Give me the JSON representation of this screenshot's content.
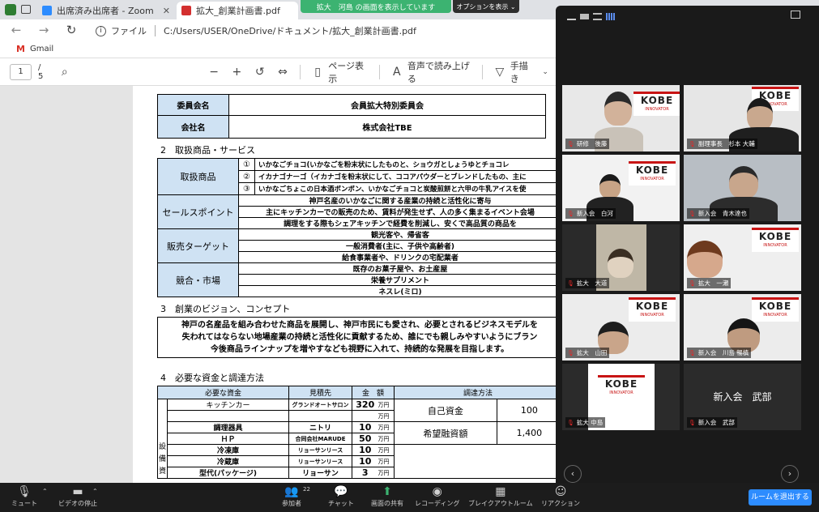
{
  "browser": {
    "tabs": [
      {
        "label": "出席済み出席者 - Zoom"
      },
      {
        "label": "拡大_創業計画書.pdf"
      }
    ],
    "address_prefix": "ファイル",
    "address": "C:/Users/USER/OneDrive/ドキュメント/拡大_創業計画書.pdf",
    "bookmark": "Gmail"
  },
  "share": {
    "banner": "拡大　河島 の画面を表示しています",
    "options": "オプションを表示 ⌄"
  },
  "pdf_toolbar": {
    "page": "1",
    "total": "/ 5",
    "page_view": "ページ表示",
    "read_aloud": "音声で読み上げる",
    "draw": "手描き"
  },
  "doc": {
    "committee_label": "委員会名",
    "committee_value": "会員拡大特別委員会",
    "company_label": "会社名",
    "company_value": "株式会社TBE",
    "section2": "2　取扱商品・サービス",
    "products_label": "取扱商品",
    "products": [
      {
        "num": "①",
        "text": "いかなごチョコ(いかなごを粉末状にしたものと、ショウガとしょうゆとチョコレ"
      },
      {
        "num": "②",
        "text": "イカナゴナーゴ（イカナゴを粉末状にして、ココアパウダーとブレンドしたもの、主に"
      },
      {
        "num": "③",
        "text": "いかなごちょこの日本酒ボンボン、いかなごチョコと炭酸煎餅と六甲の牛乳アイスを使"
      }
    ],
    "selling_label": "セールスポイント",
    "selling": [
      "神戸名産のいかなごに関する産業の持続と活性化に寄与",
      "主にキッチンカーでの販売のため、賃料が発生せず、人の多く集まるイベント会場",
      "調理をする際もシェアキッチンで経費を削減し、安くで高品質の商品を"
    ],
    "target_label": "販売ターゲット",
    "targets": [
      "観光客や、帰省客",
      "一般消費者(主に、子供や高齢者)",
      "給食事業者や、ドリンクの宅配業者"
    ],
    "market_label": "競合・市場",
    "markets": [
      "既存のお菓子屋や、お土産屋",
      "栄養サプリメント",
      "ネスレ(ミロ)"
    ],
    "section3": "3　創業のビジョン、コンセプト",
    "vision": [
      "神戸の名産品を組み合わせた商品を展開し、神戸市民にも愛され、必要とされるビジネスモデルを",
      "失われてはならない地場産業の持続と活性化に貢献するため、誰にでも親しみやすいようにブラン",
      "今後商品ラインナップを増やすなども視野に入れて、持続的な発展を目指します。"
    ],
    "section4": "4　必要な資金と調達方法",
    "funds_headers": [
      "必要な資金",
      "見積先",
      "金　額",
      "調達方法"
    ],
    "side_label": [
      "設",
      "備",
      "資"
    ],
    "funds": [
      {
        "item": "キッチンカー",
        "vendor": "グランドオートサロン",
        "amount": "320",
        "unit": "万円"
      },
      {
        "item": "",
        "vendor": "",
        "amount": "",
        "unit": "万円"
      },
      {
        "item": "調理器具",
        "vendor": "ニトリ",
        "amount": "10",
        "unit": "万円"
      },
      {
        "item": "ＨＰ",
        "vendor": "合同会社MARUDE",
        "amount": "50",
        "unit": "万円"
      },
      {
        "item": "冷凍庫",
        "vendor": "リョーサンリース",
        "amount": "10",
        "unit": "万円"
      },
      {
        "item": "冷蔵庫",
        "vendor": "リョーサンリース",
        "amount": "10",
        "unit": "万円"
      },
      {
        "item": "型代(パッケージ)",
        "vendor": "リョーサン",
        "amount": "3",
        "unit": "万円"
      }
    ],
    "procurement": [
      {
        "label": "自己資金",
        "value": "100"
      },
      {
        "label": "希望融資額",
        "value": "1,400"
      }
    ]
  },
  "participants": [
    {
      "name": "研修　後藤"
    },
    {
      "name": "副理事長　杉本 大輔"
    },
    {
      "name": "新入会　白河"
    },
    {
      "name": "新入会　青木達也"
    },
    {
      "name": "拡大　大道"
    },
    {
      "name": "拡大　一瀬"
    },
    {
      "name": "拡大　山田"
    },
    {
      "name": "新入会　川島 暢槙"
    },
    {
      "name": "拡大 中島"
    },
    {
      "name": "新入会　武部",
      "center_label": "新入会　武部"
    }
  ],
  "logo": {
    "top": "KOBE",
    "bottom": "INNOVATOR",
    "sub": "革新的な新時代を"
  },
  "controls": {
    "mute": "ミュート",
    "video": "ビデオの停止",
    "participants": "参加者",
    "participants_count": "22",
    "chat": "チャット",
    "share": "画面の共有",
    "record": "レコーディング",
    "breakout": "ブレイクアウトルーム",
    "reaction": "リアクション",
    "leave": "ルームを退出する"
  },
  "colors": {
    "share_green": "#3cb371",
    "zoom_blue": "#2d8cff",
    "header_blue": "#cfe2f3"
  }
}
